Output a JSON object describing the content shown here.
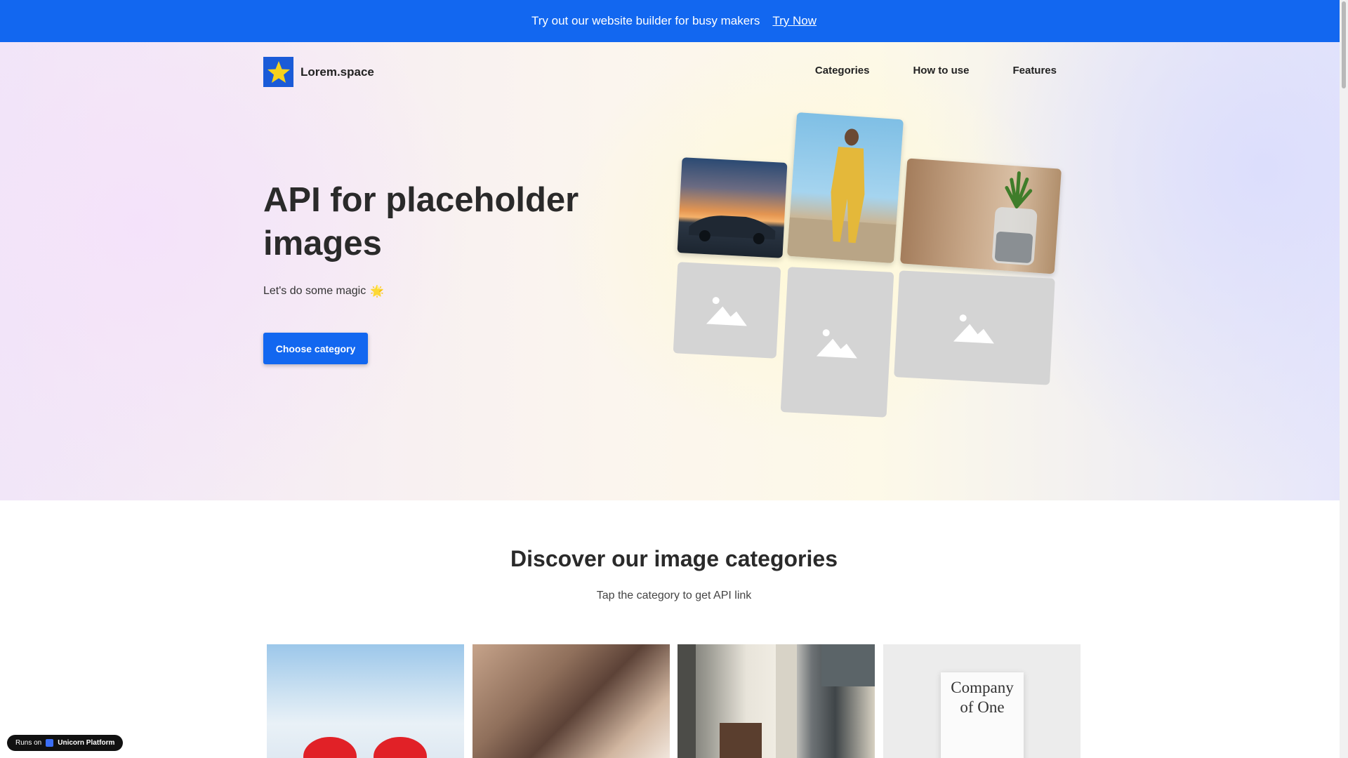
{
  "banner": {
    "text": "Try out our website builder for busy makers",
    "link": "Try Now"
  },
  "header": {
    "brand": "Lorem.space",
    "nav": [
      {
        "label": "Categories"
      },
      {
        "label": "How to use"
      },
      {
        "label": "Features"
      }
    ]
  },
  "hero": {
    "title": "API for placeholder images",
    "subtitle": "Let's do some magic",
    "subtitle_emoji": "🌟",
    "cta": "Choose category"
  },
  "categories_section": {
    "title": "Discover our image categories",
    "subtitle": "Tap the category to get API link",
    "book_title_line1": "Company",
    "book_title_line2": "of One"
  },
  "badge": {
    "prefix": "Runs on",
    "name": "Unicorn Platform"
  },
  "colors": {
    "brand_blue": "#1267f0",
    "placeholder_gray": "#d4d4d4"
  }
}
